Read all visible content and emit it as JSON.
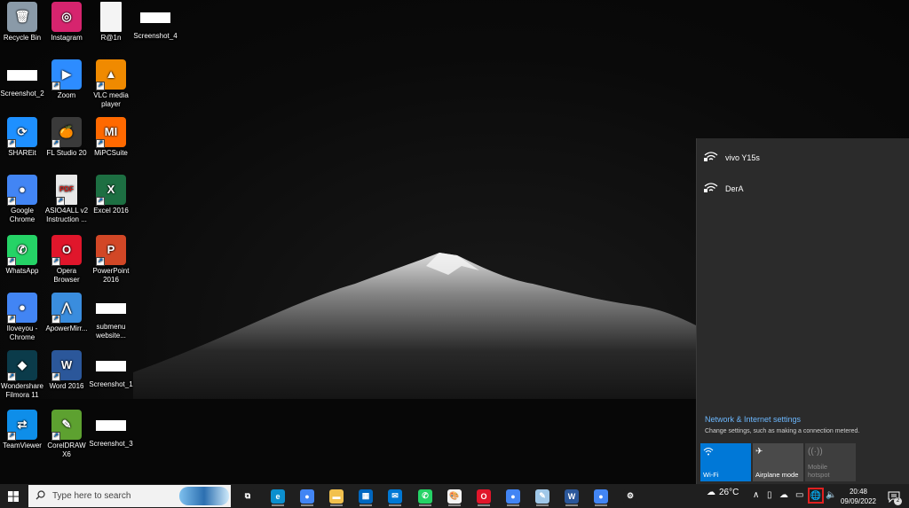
{
  "desktop": {
    "icons": [
      {
        "label": "Recycle Bin",
        "icon": "recycle-bin-icon",
        "color": "#8a9aa8",
        "glyph": "🗑"
      },
      {
        "label": "Instagram",
        "icon": "instagram-icon",
        "color": "#d6246e",
        "glyph": "◎"
      },
      {
        "label": "R@1n",
        "icon": "document-icon",
        "color": "#f4f4f4",
        "glyph": ""
      },
      {
        "label": "Screenshot_4",
        "icon": "image-file-icon",
        "color": "#ffffff",
        "glyph": ""
      },
      {
        "label": "Screenshot_2",
        "icon": "image-file-icon",
        "color": "#ffffff",
        "glyph": ""
      },
      {
        "label": "Zoom",
        "icon": "zoom-icon",
        "color": "#2d8cff",
        "glyph": "▶"
      },
      {
        "label": "VLC media player",
        "icon": "vlc-icon",
        "color": "#f08a00",
        "glyph": "▲"
      },
      {
        "label": "SHAREit",
        "icon": "shareit-icon",
        "color": "#1e90ff",
        "glyph": "⟳"
      },
      {
        "label": "FL Studio 20",
        "icon": "fl-studio-icon",
        "color": "#3a3a3a",
        "glyph": "🍊"
      },
      {
        "label": "MiPCSuite",
        "icon": "mi-pc-suite-icon",
        "color": "#ff6900",
        "glyph": "MI"
      },
      {
        "label": "Google Chrome",
        "icon": "chrome-icon",
        "color": "#4285f4",
        "glyph": "●"
      },
      {
        "label": "ASIO4ALL v2 Instruction ...",
        "icon": "pdf-icon",
        "color": "#e8e8e8",
        "glyph": "PDF"
      },
      {
        "label": "Excel 2016",
        "icon": "excel-icon",
        "color": "#1d6f42",
        "glyph": "X"
      },
      {
        "label": "WhatsApp",
        "icon": "whatsapp-icon",
        "color": "#25d366",
        "glyph": "✆"
      },
      {
        "label": "Opera Browser",
        "icon": "opera-icon",
        "color": "#e0162b",
        "glyph": "O"
      },
      {
        "label": "PowerPoint 2016",
        "icon": "powerpoint-icon",
        "color": "#d24726",
        "glyph": "P"
      },
      {
        "label": "Iloveyou - Chrome",
        "icon": "chrome-profile-icon",
        "color": "#4285f4",
        "glyph": "●"
      },
      {
        "label": "ApowerMirr...",
        "icon": "apowermirror-icon",
        "color": "#3a8dde",
        "glyph": "⋀"
      },
      {
        "label": "submenu website...",
        "icon": "image-file-icon",
        "color": "#ffffff",
        "glyph": ""
      },
      {
        "label": "Wondershare Filmora 11",
        "icon": "filmora-icon",
        "color": "#0b3b4a",
        "glyph": "◆"
      },
      {
        "label": "Word 2016",
        "icon": "word-icon",
        "color": "#2b579a",
        "glyph": "W"
      },
      {
        "label": "Screenshot_1",
        "icon": "image-file-icon",
        "color": "#ffffff",
        "glyph": ""
      },
      {
        "label": "TeamViewer",
        "icon": "teamviewer-icon",
        "color": "#0e8ee9",
        "glyph": "⇄"
      },
      {
        "label": "CorelDRAW X6",
        "icon": "coreldraw-icon",
        "color": "#5da130",
        "glyph": "✎"
      },
      {
        "label": "Screenshot_3",
        "icon": "image-file-icon",
        "color": "#ffffff",
        "glyph": ""
      }
    ]
  },
  "network_flyout": {
    "networks": [
      {
        "name": "vivo Y15s",
        "icon": "wifi-secured-icon"
      },
      {
        "name": "DerA",
        "icon": "wifi-secured-icon"
      }
    ],
    "settings_link": "Network & Internet settings",
    "settings_desc": "Change settings, such as making a connection metered.",
    "tiles": {
      "wifi": {
        "label": "Wi-Fi",
        "icon": "wifi-icon"
      },
      "airplane": {
        "label": "Airplane mode",
        "icon": "airplane-icon"
      },
      "hotspot": {
        "label": "Mobile hotspot",
        "icon": "hotspot-icon"
      }
    }
  },
  "taskbar": {
    "search_placeholder": "Type here to search",
    "apps": [
      {
        "name": "task-view",
        "icon": "task-view-icon",
        "color": "#1f1f1f",
        "glyph": "⧉"
      },
      {
        "name": "edge",
        "icon": "edge-icon",
        "color": "#0c8fce",
        "glyph": "e"
      },
      {
        "name": "chrome",
        "icon": "chrome-icon",
        "color": "#4285f4",
        "glyph": "●"
      },
      {
        "name": "file-explorer",
        "icon": "folder-icon",
        "color": "#f2c14e",
        "glyph": "▬"
      },
      {
        "name": "microsoft-store",
        "icon": "store-icon",
        "color": "#0067c0",
        "glyph": "▦"
      },
      {
        "name": "mail",
        "icon": "mail-icon",
        "color": "#0078d4",
        "glyph": "✉"
      },
      {
        "name": "whatsapp",
        "icon": "whatsapp-icon",
        "color": "#25d366",
        "glyph": "✆"
      },
      {
        "name": "paint",
        "icon": "paint-icon",
        "color": "#f4f4f4",
        "glyph": "🎨"
      },
      {
        "name": "opera",
        "icon": "opera-icon",
        "color": "#e0162b",
        "glyph": "O"
      },
      {
        "name": "chrome-profile",
        "icon": "chrome-icon",
        "color": "#4285f4",
        "glyph": "●"
      },
      {
        "name": "notepad",
        "icon": "notepad-icon",
        "color": "#9fc7e8",
        "glyph": "✎"
      },
      {
        "name": "word",
        "icon": "word-icon",
        "color": "#2b579a",
        "glyph": "W"
      },
      {
        "name": "chrome-2",
        "icon": "chrome-icon",
        "color": "#4285f4",
        "glyph": "●"
      },
      {
        "name": "settings",
        "icon": "gear-icon",
        "color": "#1f1f1f",
        "glyph": "⚙"
      }
    ],
    "weather": {
      "temp": "26°C",
      "icon": "cloud-icon"
    },
    "clock": {
      "time": "20:48",
      "date": "09/09/2022"
    },
    "notification_count": "2"
  },
  "colors": {
    "accent": "#0078d7",
    "link": "#6cb8ff",
    "highlight_box": "#e02020"
  }
}
